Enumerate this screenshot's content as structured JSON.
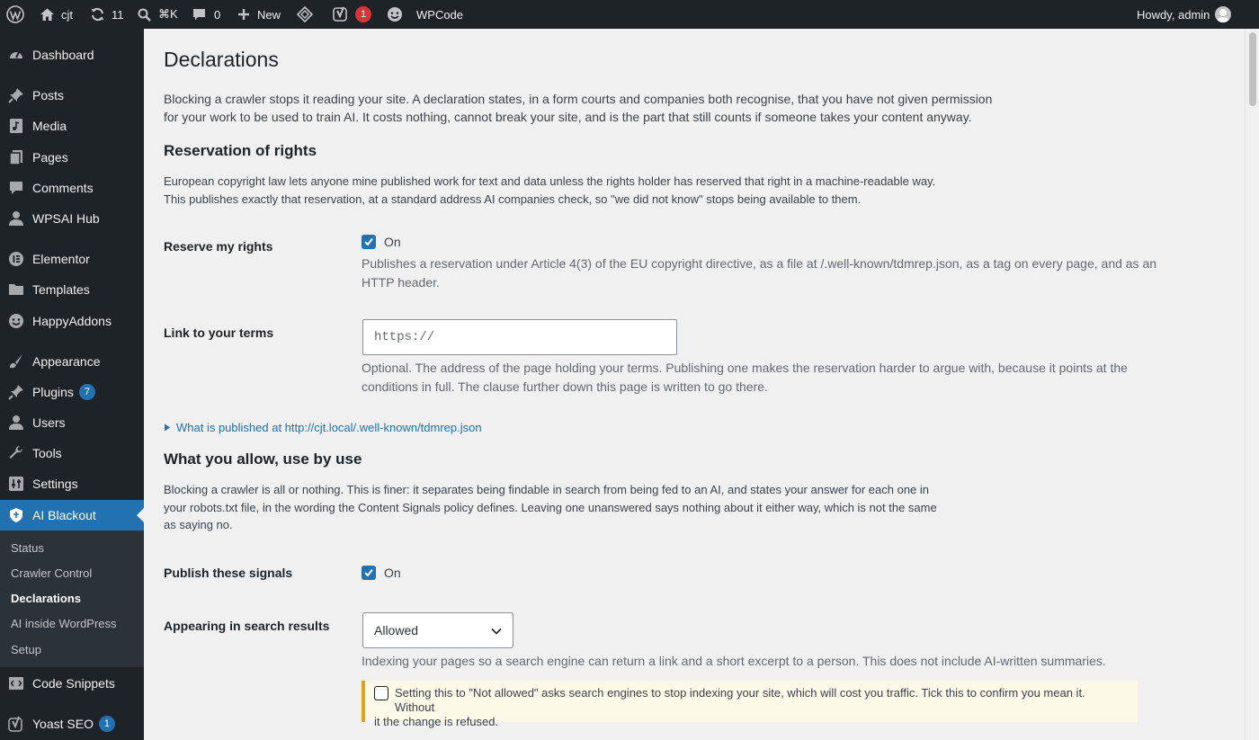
{
  "adminbar": {
    "site_name": "cjt",
    "updates_count": "11",
    "search_shortcut": "⌘K",
    "comments_count": "0",
    "new_label": "New",
    "yoast_badge": "1",
    "wpcode_label": "WPCode",
    "howdy": "Howdy, admin"
  },
  "sidebar": {
    "items": [
      {
        "label": "Dashboard",
        "icon": "dashboard-icon"
      },
      {
        "label": "Posts",
        "icon": "pin-icon"
      },
      {
        "label": "Media",
        "icon": "media-icon"
      },
      {
        "label": "Pages",
        "icon": "page-icon"
      },
      {
        "label": "Comments",
        "icon": "comment-icon"
      },
      {
        "label": "WPSAI Hub",
        "icon": "user-icon"
      },
      {
        "label": "Elementor",
        "icon": "elementor-icon"
      },
      {
        "label": "Templates",
        "icon": "folder-icon"
      },
      {
        "label": "HappyAddons",
        "icon": "happyaddons-icon"
      },
      {
        "label": "Appearance",
        "icon": "brush-icon"
      },
      {
        "label": "Plugins",
        "icon": "plugin-icon",
        "badge": "7"
      },
      {
        "label": "Users",
        "icon": "user-icon"
      },
      {
        "label": "Tools",
        "icon": "wrench-icon"
      },
      {
        "label": "Settings",
        "icon": "sliders-icon"
      },
      {
        "label": "AI Blackout",
        "icon": "shield-icon"
      },
      {
        "label": "Code Snippets",
        "icon": "code-icon"
      },
      {
        "label": "Yoast SEO",
        "icon": "yoast-icon",
        "badge": "1"
      }
    ],
    "submenu": [
      "Status",
      "Crawler Control",
      "Declarations",
      "AI inside WordPress",
      "Setup"
    ]
  },
  "page": {
    "title": "Declarations",
    "intro_line1": "Blocking a crawler stops it reading your site. A declaration states, in a form courts and companies both recognise, that you have not given permission",
    "intro_line2": "for your work to be used to train AI. It costs nothing, cannot break your site, and is the part that still counts if someone takes your content anyway."
  },
  "reservation": {
    "heading": "Reservation of rights",
    "desc_line1": "European copyright law lets anyone mine published work for text and data unless the rights holder has reserved that right in a machine-readable way.",
    "desc_line2": "This publishes exactly that reservation, at a standard address AI companies check, so \"we did not know\" stops being available to them.",
    "reserve_label": "Reserve my rights",
    "reserve_checked": true,
    "reserve_value": "On",
    "reserve_help_line1": "Publishes a reservation under Article 4(3) of the EU copyright directive, as a file at /.well-known/tdmrep.json, as a tag on every page, and as an",
    "reserve_help_line2": "HTTP header.",
    "terms_label": "Link to your terms",
    "terms_placeholder": "https://",
    "terms_help_line1": "Optional. The address of the page holding your terms. Publishing one makes the reservation harder to argue with, because it points at the",
    "terms_help_line2": "conditions in full. The clause further down this page is written to go there.",
    "details_summary": "What is published at http://cjt.local/.well-known/tdmrep.json"
  },
  "signals": {
    "heading": "What you allow, use by use",
    "desc_line1": "Blocking a crawler is all or nothing. This is finer: it separates being findable in search from being fed to an AI, and states your answer for each one in",
    "desc_line2": "your robots.txt file, in the wording the Content Signals policy defines. Leaving one unanswered says nothing about it either way, which is not the same",
    "desc_line3": "as saying no.",
    "publish_label": "Publish these signals",
    "publish_checked": true,
    "publish_value": "On",
    "search_label": "Appearing in search results",
    "search_selected": "Allowed",
    "search_help": "Indexing your pages so a search engine can return a link and a short excerpt to a person. This does not include AI-written summaries.",
    "notice_line1": "Setting this to \"Not allowed\" asks search engines to stop indexing your site, which will cost you traffic. Tick this to confirm you mean it. Without",
    "notice_line2": "it the change is refused.",
    "notice_checked": false
  },
  "colors": {
    "accent": "#2271b1",
    "adminbar_bg": "#1d2327",
    "notice_border": "#dba617",
    "badge_red": "#d63638"
  }
}
